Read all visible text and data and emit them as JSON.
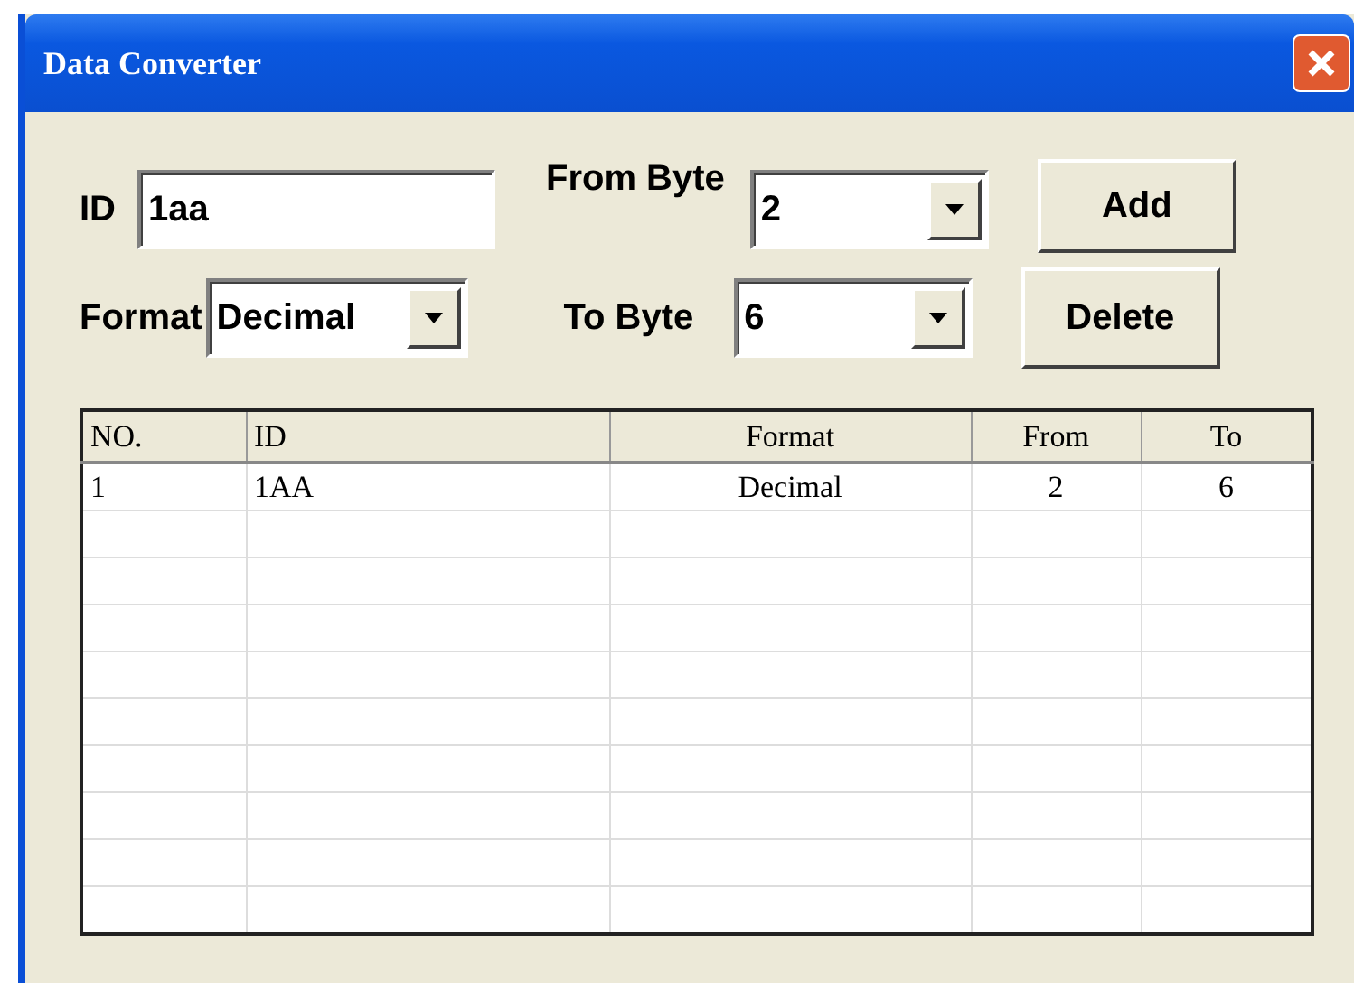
{
  "window": {
    "title": "Data Converter"
  },
  "form": {
    "id": {
      "label": "ID",
      "value": "1aa"
    },
    "format": {
      "label": "Format",
      "value": "Decimal"
    },
    "from_byte": {
      "label": "From Byte",
      "value": "2"
    },
    "to_byte": {
      "label": "To Byte",
      "value": "6"
    }
  },
  "buttons": [
    "Add",
    "Delete"
  ],
  "table": {
    "columns": [
      "NO.",
      "ID",
      "Format",
      "From",
      "To"
    ],
    "rows": [
      [
        "1",
        "1AA",
        "Decimal",
        "2",
        "6"
      ]
    ]
  }
}
